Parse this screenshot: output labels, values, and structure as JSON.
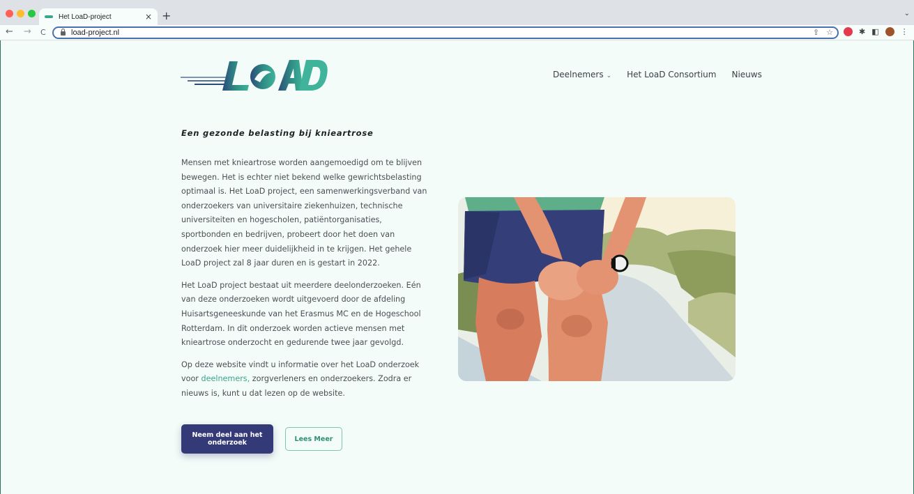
{
  "browser": {
    "tab_title": "Het LoaD-project",
    "tab_close": "×",
    "new_tab": "+",
    "url": "load-project.nl",
    "back": "←",
    "forward": "→",
    "reload": "C"
  },
  "site": {
    "logo_text": "LoAD",
    "nav": {
      "participants": "Deelnemers",
      "consortium": "Het LoaD Consortium",
      "news": "Nieuws"
    },
    "headline": "Een gezonde belasting bij knieartrose",
    "paragraph1": "Mensen met knieartrose worden aangemoedigd om te blijven bewegen. Het is echter niet bekend welke gewrichtsbelasting optimaal is. Het LoaD project, een samenwerkingsverband van onderzoekers van universitaire ziekenhuizen, technische universiteiten en hogescholen, patiëntorganisaties, sportbonden en bedrijven, probeert door het doen van onderzoek hier meer duidelijkheid in te krijgen. Het gehele LoaD project zal 8 jaar duren en is gestart in 2022.",
    "paragraph2": "Het LoaD project bestaat uit meerdere deelonderzoeken. Eén van deze onderzoeken wordt uitgevoerd door de afdeling Huisartsgeneeskunde van het Erasmus MC en de Hogeschool Rotterdam. In dit onderzoek worden actieve mensen met knieartrose onderzocht en gedurende twee jaar gevolgd.",
    "paragraph3_before": "Op deze website vindt u informatie over het LoaD onderzoek voor ",
    "paragraph3_link": "deelnemers,",
    "paragraph3_after": " zorgverleners en onderzoekers. Zodra er nieuws is, kunt u dat lezen op de website.",
    "cta_primary": "Neem deel aan het onderzoek",
    "cta_secondary": "Lees Meer"
  },
  "colors": {
    "brand_green": "#3aa58a",
    "brand_navy": "#343a78",
    "page_bg": "#f4fcf9"
  }
}
